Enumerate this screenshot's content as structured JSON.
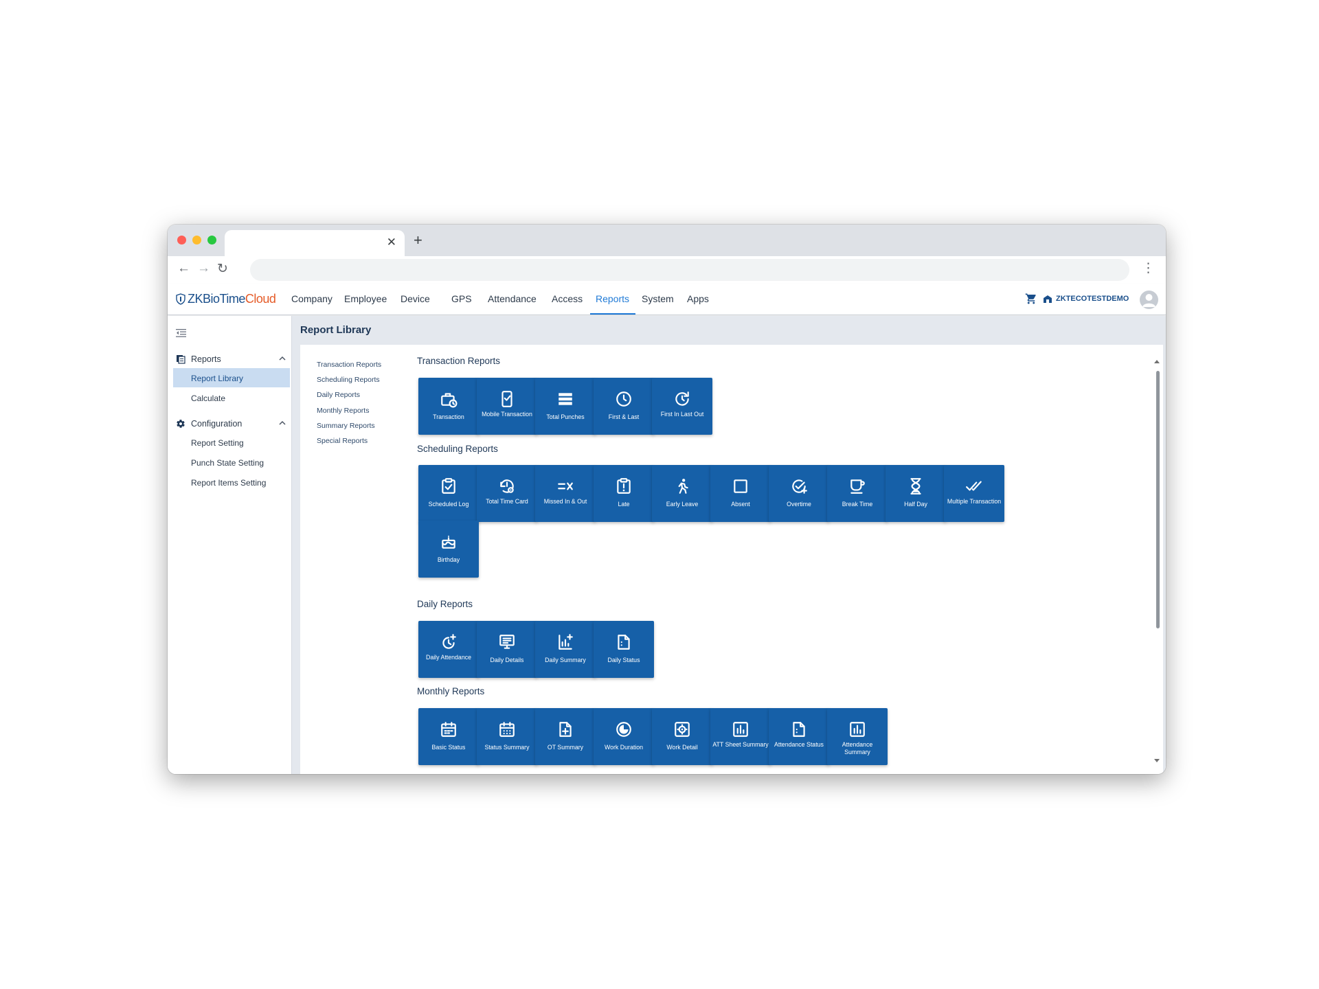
{
  "header": {
    "brand_zk": "ZKBioTime",
    "brand_cloud": "Cloud",
    "menu": [
      "Company",
      "Employee",
      "Device",
      "GPS",
      "Attendance",
      "Access",
      "Reports",
      "System",
      "Apps"
    ],
    "active_menu": "Reports",
    "company_name": "ZKTECOTESTDEMO"
  },
  "sidebar": {
    "groups": [
      {
        "label": "Reports",
        "items": [
          "Report Library",
          "Calculate"
        ]
      },
      {
        "label": "Configuration",
        "items": [
          "Report Setting",
          "Punch State Setting",
          "Report Items Setting"
        ]
      }
    ],
    "active_item": "Report Library"
  },
  "page": {
    "title": "Report Library",
    "anchors": [
      "Transaction Reports",
      "Scheduling Reports",
      "Daily Reports",
      "Monthly Reports",
      "Summary Reports",
      "Special Reports"
    ]
  },
  "sections": [
    {
      "title": "Transaction Reports",
      "tiles": [
        {
          "label": "Transaction",
          "icon": "briefcase-clock-icon"
        },
        {
          "label": "Mobile Transaction",
          "icon": "mobile-check-icon"
        },
        {
          "label": "Total Punches",
          "icon": "list-stack-icon"
        },
        {
          "label": "First & Last",
          "icon": "clock-icon"
        },
        {
          "label": "First In Last Out",
          "icon": "refresh-clock-icon"
        }
      ]
    },
    {
      "title": "Scheduling Reports",
      "tiles": [
        {
          "label": "Scheduled Log",
          "icon": "clipboard-check-icon"
        },
        {
          "label": "Total Time Card",
          "icon": "history-gear-icon"
        },
        {
          "label": "Missed In & Out",
          "icon": "equal-x-icon"
        },
        {
          "label": "Late",
          "icon": "clipboard-alert-icon"
        },
        {
          "label": "Early Leave",
          "icon": "running-person-icon"
        },
        {
          "label": "Absent",
          "icon": "square-outline-icon"
        },
        {
          "label": "Overtime",
          "icon": "check-plus-icon"
        },
        {
          "label": "Break Time",
          "icon": "coffee-cup-icon"
        },
        {
          "label": "Half Day",
          "icon": "hourglass-icon"
        },
        {
          "label": "Multiple Transaction",
          "icon": "double-check-icon"
        },
        {
          "label": "Birthday",
          "icon": "birthday-cake-icon"
        }
      ]
    },
    {
      "title": "Daily Reports",
      "tiles": [
        {
          "label": "Daily Attendance",
          "icon": "clock-plus-icon"
        },
        {
          "label": "Daily Details",
          "icon": "monitor-list-icon"
        },
        {
          "label": "Daily Summary",
          "icon": "chart-plus-icon"
        },
        {
          "label": "Daily Status",
          "icon": "document-dots-icon"
        }
      ]
    },
    {
      "title": "Monthly Reports",
      "tiles": [
        {
          "label": "Basic Status",
          "icon": "calendar-icon"
        },
        {
          "label": "Status Summary",
          "icon": "calendar-grid-icon"
        },
        {
          "label": "OT Summary",
          "icon": "document-plus-icon"
        },
        {
          "label": "Work Duration",
          "icon": "pie-clock-icon"
        },
        {
          "label": "Work Detail",
          "icon": "gear-box-icon"
        },
        {
          "label": "ATT Sheet Summary",
          "icon": "bar-chart-box-icon"
        },
        {
          "label": "Attendance Status",
          "icon": "document-dots-icon"
        },
        {
          "label": "Attendance Summary",
          "icon": "bar-chart-box-icon"
        }
      ]
    }
  ]
}
